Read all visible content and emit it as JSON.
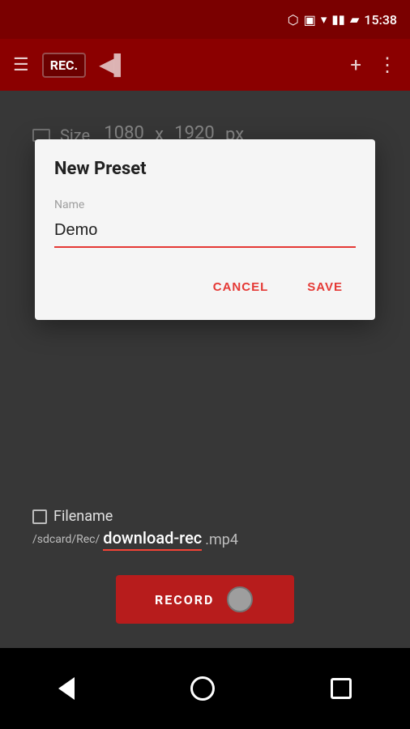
{
  "statusBar": {
    "time": "15:38",
    "icons": [
      "bluetooth",
      "vibrate",
      "wifi",
      "signal",
      "battery"
    ]
  },
  "appBar": {
    "logoText": "REC.",
    "plusLabel": "+",
    "moreLabel": "⋮"
  },
  "mainScreen": {
    "sizeLabel": "Size",
    "sizeWidth": "1080",
    "sizeSeparator": "x",
    "sizeHeight": "1920",
    "sizeSuffix": "px",
    "filenameLabel": "Filename",
    "filenamePrefix": "/sdcard/Rec/",
    "filenameValue": "download-rec",
    "filenameSuffix": ".mp4",
    "recordLabel": "RECORD"
  },
  "dialog": {
    "title": "New Preset",
    "fieldLabel": "Name",
    "fieldValue": "Demo",
    "cancelLabel": "CANCEL",
    "saveLabel": "SAVE"
  },
  "navBar": {
    "backLabel": "◀",
    "homeLabel": "○",
    "recentLabel": "□"
  }
}
